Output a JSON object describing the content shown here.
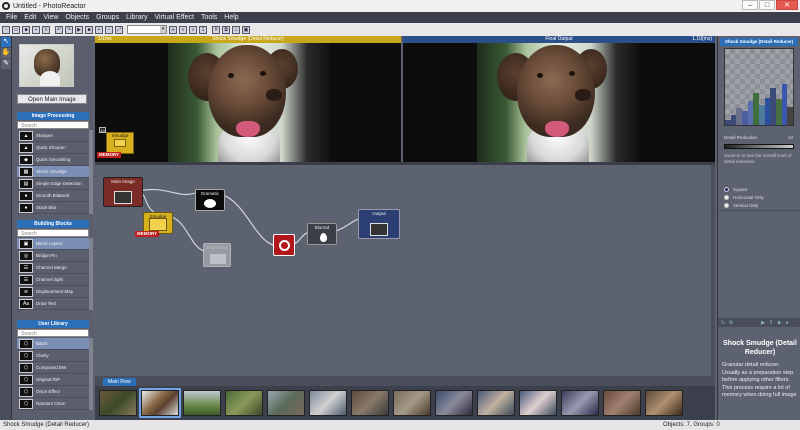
{
  "window": {
    "title": "Untitled - PhotoReactor"
  },
  "menu": [
    "File",
    "Edit",
    "View",
    "Objects",
    "Groups",
    "Library",
    "Virtual Effect",
    "Tools",
    "Help"
  ],
  "toolbar": {
    "zoom": ""
  },
  "left_panel": {
    "open_main_label": "Open Main Image",
    "image_processing": {
      "header": "Image Processing",
      "search_placeholder": "Search",
      "items": [
        "Sharpen",
        "Quick Sharpen",
        "Quick Smoothing",
        "Shock Smudge",
        "Simple Edge Detection",
        "Smooth Bilateral",
        "Stack Blur"
      ]
    },
    "building_blocks": {
      "header": "Building Blocks",
      "search_placeholder": "Search",
      "items": [
        "Blend Layers",
        "Bridge Pin",
        "Channel Merge",
        "Channel Split",
        "Displacement Map",
        "Draw Text"
      ]
    },
    "user_library": {
      "header": "User Library",
      "search_placeholder": "Search",
      "items": [
        "Batch",
        "Clarity",
        "Composed BW",
        "Original RIP",
        "Orton Effect",
        "Random Orton"
      ]
    }
  },
  "preview_left": {
    "title": "Shock Smudge (Detail Reducer)",
    "meta": "1/1ms"
  },
  "preview_right": {
    "title": "Final Output",
    "zoom": "1.10(ms)"
  },
  "preview_node": {
    "label": "Smudge",
    "memory": "MEMORY",
    "index": "10"
  },
  "graph": {
    "nodes": {
      "main_image": "Main Image",
      "smudge": "Smudge",
      "dramatic": "Dramatic",
      "blurred": "Blurred",
      "output": "Output",
      "inactive": "Brightness"
    },
    "memory_badge": "MEMORY"
  },
  "right_panel": {
    "header": "Shock Smudge (Detail Reducer)",
    "param_label": "Detail Reduction",
    "param_value": "10",
    "param_help": "Zoom-in to see the overall level of detail reduction",
    "radios": [
      {
        "label": "Square",
        "checked": true
      },
      {
        "label": "Horizontal Only",
        "checked": false
      },
      {
        "label": "Vertical Only",
        "checked": false
      }
    ],
    "desc_title": "Shock Smudge (Detail Reducer)",
    "desc_body": "Granular detail reducer. Usually as a preparation step before applying other filters. This process require a lot of memory when doing full image"
  },
  "tabs": [
    "Main Flow"
  ],
  "status": {
    "left": "Shock Smudge (Detail Reducer)",
    "right": "Objects: 7, Groups: 0"
  },
  "colors": {
    "accent": "#2b6fb9",
    "node_yellow": "#d6b11d",
    "memory_red": "#c01d1d"
  }
}
